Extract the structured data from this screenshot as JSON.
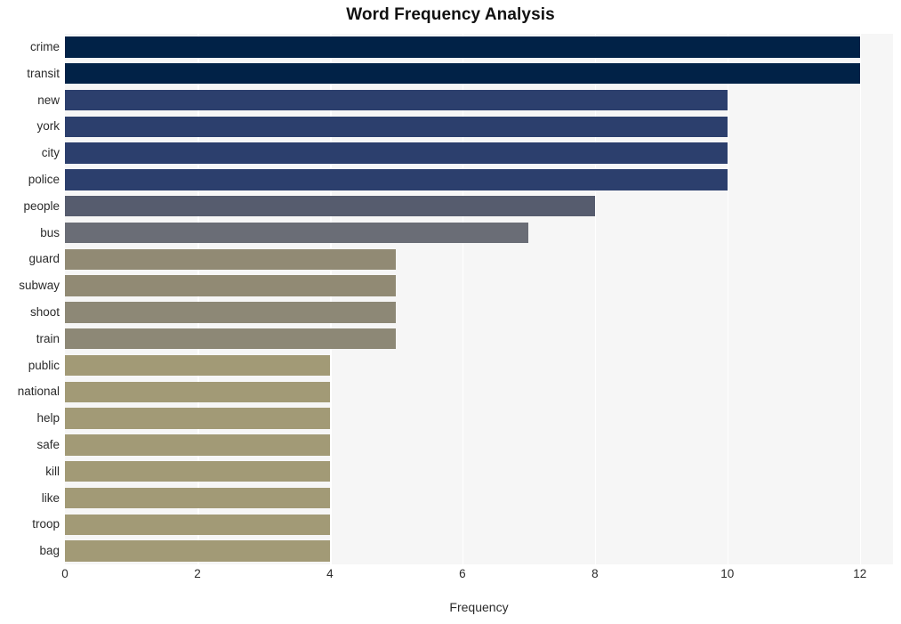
{
  "chart_data": {
    "type": "bar",
    "orientation": "horizontal",
    "title": "Word Frequency Analysis",
    "xlabel": "Frequency",
    "ylabel": "",
    "categories": [
      "crime",
      "transit",
      "new",
      "york",
      "city",
      "police",
      "people",
      "bus",
      "guard",
      "subway",
      "shoot",
      "train",
      "public",
      "national",
      "help",
      "safe",
      "kill",
      "like",
      "troop",
      "bag"
    ],
    "values": [
      12,
      12,
      10,
      10,
      10,
      10,
      8,
      7,
      5,
      5,
      5,
      5,
      4,
      4,
      4,
      4,
      4,
      4,
      4,
      4
    ],
    "bar_colors": [
      "#012247",
      "#012247",
      "#2c3f6d",
      "#2c3f6d",
      "#2c3f6d",
      "#2c3f6d",
      "#565c6e",
      "#6a6d76",
      "#918a74",
      "#918a74",
      "#8d8876",
      "#8d8876",
      "#a29a76",
      "#a29a76",
      "#a29a76",
      "#a29a76",
      "#a29a76",
      "#a29a76",
      "#a29a76",
      "#a29a76"
    ],
    "xlim": [
      0,
      12.5
    ],
    "xticks": [
      0,
      2,
      4,
      6,
      8,
      10,
      12
    ],
    "xtick_labels": [
      "0",
      "2",
      "4",
      "6",
      "8",
      "10",
      "12"
    ],
    "grid": true,
    "grid_axis": "x",
    "grid_color": "#ffffff",
    "plot_background": "#f6f6f6",
    "figure_background": "#ffffff",
    "title_color": "#111111",
    "tick_label_color": "#2b2b2b",
    "legend": null
  }
}
